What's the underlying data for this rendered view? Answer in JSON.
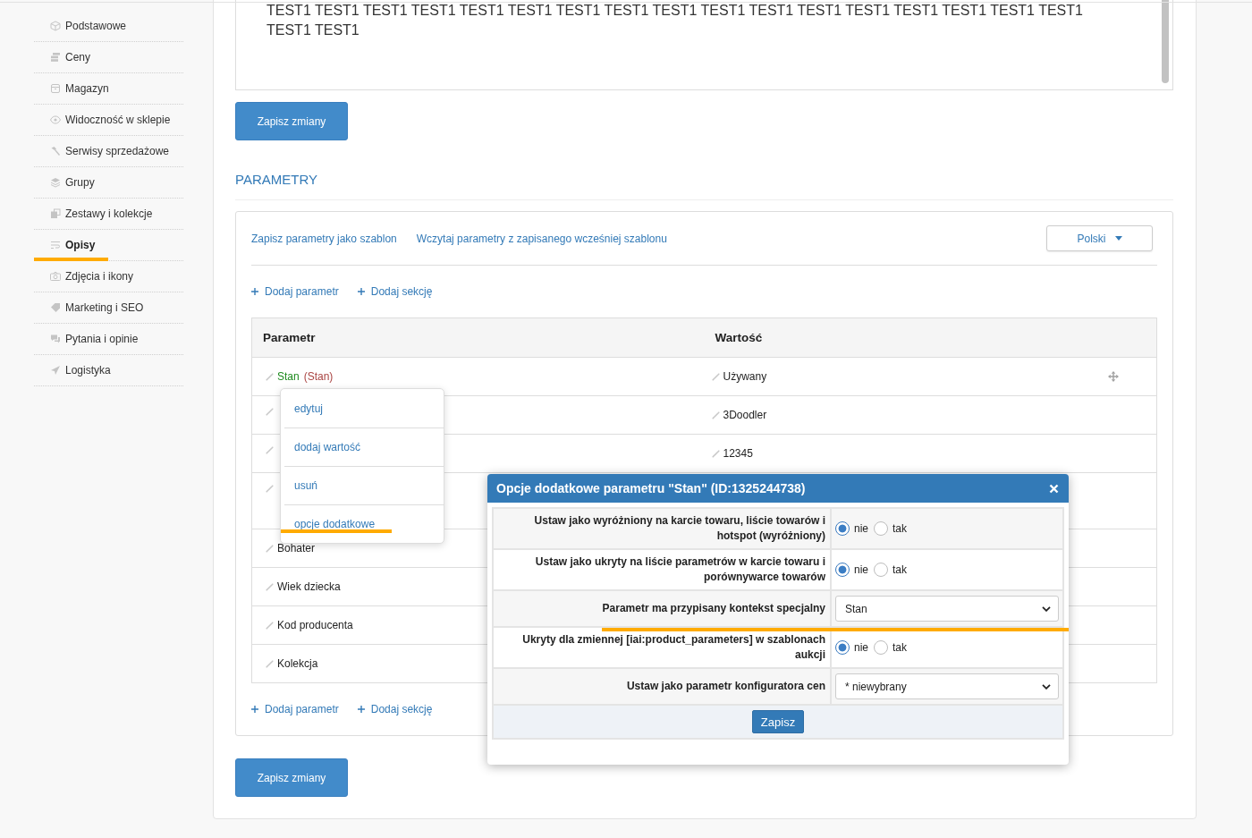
{
  "sidebar": {
    "items": [
      {
        "label": "Podstawowe",
        "selected": false,
        "highlighted": false
      },
      {
        "label": "Ceny",
        "selected": false,
        "highlighted": false
      },
      {
        "label": "Magazyn",
        "selected": false,
        "highlighted": false
      },
      {
        "label": "Widoczność w sklepie",
        "selected": false,
        "highlighted": false
      },
      {
        "label": "Serwisy sprzedażowe",
        "selected": false,
        "highlighted": false
      },
      {
        "label": "Grupy",
        "selected": false,
        "highlighted": false
      },
      {
        "label": "Zestawy i kolekcje",
        "selected": false,
        "highlighted": false
      },
      {
        "label": "Opisy",
        "selected": true,
        "highlighted": true
      },
      {
        "label": "Zdjęcia i ikony",
        "selected": false,
        "highlighted": false
      },
      {
        "label": "Marketing i SEO",
        "selected": false,
        "highlighted": false
      },
      {
        "label": "Pytania i opinie",
        "selected": false,
        "highlighted": false
      },
      {
        "label": "Logistyka",
        "selected": false,
        "highlighted": false
      }
    ]
  },
  "editor": {
    "text": "TEST1 TEST1 TEST1 TEST1 TEST1 TEST1 TEST1 TEST1 TEST1 TEST1 TEST1 TEST1 TEST1 TEST1 TEST1 TEST1 TEST1 TEST1 TEST1"
  },
  "top_save_button": {
    "label": "Zapisz zmiany"
  },
  "parameters": {
    "heading": "PARAMETRY",
    "template_links": [
      "Zapisz parametry jako szablon",
      "Wczytaj parametry z zapisanego wcześniej szablonu"
    ],
    "language_dropdown": {
      "value": "Polski"
    },
    "add_links_top": [
      "Dodaj parametr",
      "Dodaj sekcję"
    ],
    "table": {
      "columns": [
        "Parametr",
        "Wartość"
      ],
      "rows": [
        {
          "kind": "context",
          "name": "Stan",
          "context": "(Stan)",
          "value": "Używany",
          "drag_handle": true
        },
        {
          "kind": "plain",
          "value": "3Doodler",
          "drag_handle": false
        },
        {
          "kind": "plain",
          "value": "12345",
          "drag_handle": false
        },
        {
          "kind": "plain",
          "drag_handle": false
        },
        {
          "kind": "plain",
          "name": "Bohater",
          "drag_handle": false
        },
        {
          "kind": "plain",
          "name": "Wiek dziecka",
          "drag_handle": false
        },
        {
          "kind": "plain",
          "name": "Kod producenta",
          "drag_handle": false
        },
        {
          "kind": "plain",
          "name": "Kolekcja",
          "drag_handle": false
        }
      ]
    },
    "context_menu": {
      "items": [
        {
          "label": "edytuj",
          "highlighted": false
        },
        {
          "label": "dodaj wartość",
          "highlighted": false
        },
        {
          "label": "usuń",
          "highlighted": false
        },
        {
          "label": "opcje dodatkowe",
          "highlighted": true
        }
      ]
    },
    "add_links_bottom": [
      "Dodaj parametr",
      "Dodaj sekcję"
    ]
  },
  "bottom_save_button": {
    "label": "Zapisz zmiany"
  },
  "dialog": {
    "title": "Opcje dodatkowe parametru \"Stan\" (ID:1325244738)",
    "rows": [
      {
        "kind": "radio",
        "label": "Ustaw jako wyróżniony na karcie towaru, liście towarów i hotspot (wyróżniony)",
        "options": [
          {
            "label": "nie",
            "selected": true
          },
          {
            "label": "tak",
            "selected": false
          }
        ],
        "highlighted": false
      },
      {
        "kind": "radio",
        "label": "Ustaw jako ukryty na liście parametrów w karcie towaru i porównywarce towarów",
        "options": [
          {
            "label": "nie",
            "selected": true
          },
          {
            "label": "tak",
            "selected": false
          }
        ],
        "highlighted": false
      },
      {
        "kind": "select",
        "label": "Parametr ma przypisany kontekst specjalny",
        "value": "Stan",
        "highlighted": true
      },
      {
        "kind": "radio",
        "label": "Ukryty dla zmiennej [iai:product_parameters] w szablonach aukcji",
        "options": [
          {
            "label": "nie",
            "selected": true
          },
          {
            "label": "tak",
            "selected": false
          }
        ],
        "highlighted": false
      },
      {
        "kind": "select",
        "label": "Ustaw jako parametr konfiguratora cen",
        "value": "* niewybrany",
        "highlighted": false
      }
    ],
    "submit": "Zapisz"
  }
}
